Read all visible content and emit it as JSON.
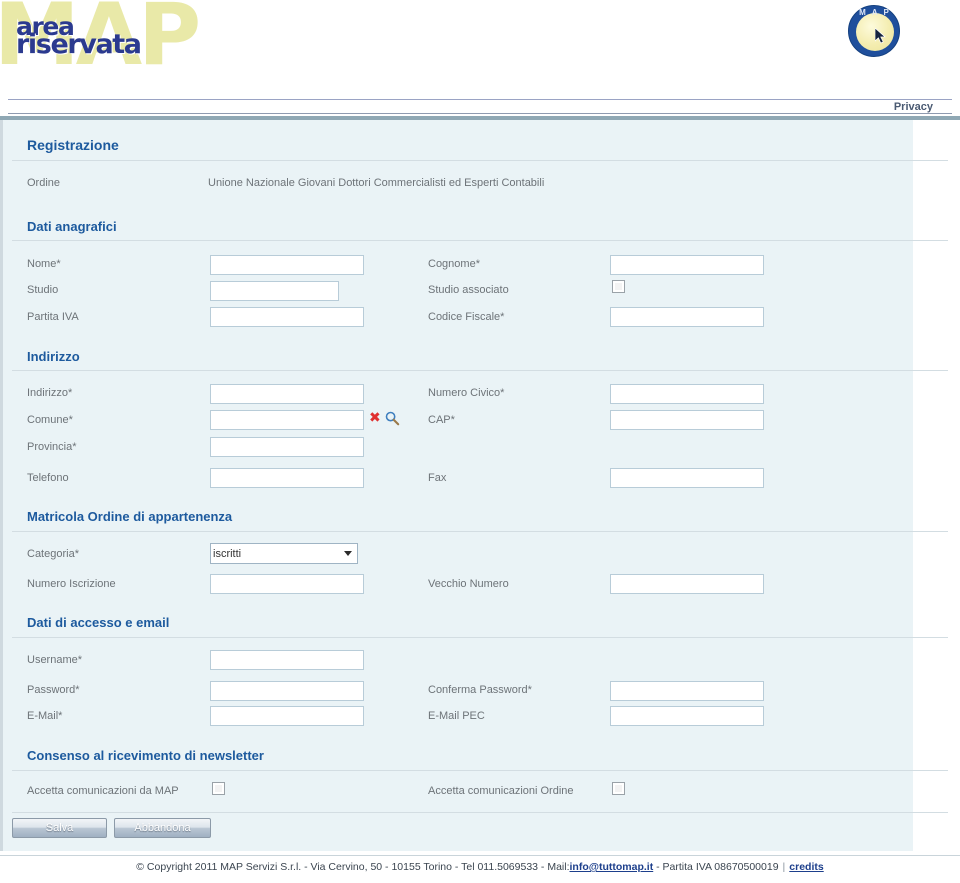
{
  "header": {
    "logo_ghost": "MAP",
    "logo_line1": "area",
    "logo_line2": "riservata",
    "badge_text": "M A P",
    "privacy_label": "Privacy"
  },
  "page": {
    "title": "Registrazione",
    "ordine_label": "Ordine",
    "ordine_value": "Unione Nazionale Giovani Dottori Commercialisti ed Esperti Contabili"
  },
  "sections": {
    "anagrafici": {
      "title": "Dati anagrafici",
      "fields": {
        "nome_label": "Nome*",
        "nome_value": "",
        "cognome_label": "Cognome*",
        "cognome_value": "",
        "studio_label": "Studio",
        "studio_value": "",
        "studio_associato_label": "Studio associato",
        "partita_iva_label": "Partita IVA",
        "partita_iva_value": "",
        "codice_fiscale_label": "Codice Fiscale*",
        "codice_fiscale_value": ""
      }
    },
    "indirizzo": {
      "title": "Indirizzo",
      "fields": {
        "indirizzo_label": "Indirizzo*",
        "indirizzo_value": "",
        "numero_civico_label": "Numero Civico*",
        "numero_civico_value": "",
        "comune_label": "Comune*",
        "comune_value": "",
        "cap_label": "CAP*",
        "cap_value": "",
        "provincia_label": "Provincia*",
        "provincia_value": "",
        "telefono_label": "Telefono",
        "telefono_value": "",
        "fax_label": "Fax",
        "fax_value": ""
      },
      "icons": {
        "clear_icon": "clear-comune-icon",
        "search_icon": "search-comune-icon",
        "clear_glyph": "✖"
      }
    },
    "matricola": {
      "title": "Matricola Ordine di appartenenza",
      "fields": {
        "categoria_label": "Categoria*",
        "categoria_value": "iscritti",
        "categoria_options": [
          "iscritti"
        ],
        "numero_iscrizione_label": "Numero Iscrizione",
        "numero_iscrizione_value": "",
        "vecchio_numero_label": "Vecchio Numero",
        "vecchio_numero_value": ""
      }
    },
    "accesso": {
      "title": "Dati di accesso e email",
      "fields": {
        "username_label": "Username*",
        "username_value": "",
        "password_label": "Password*",
        "password_value": "",
        "conferma_password_label": "Conferma Password*",
        "conferma_password_value": "",
        "email_label": "E-Mail*",
        "email_value": "",
        "email_pec_label": "E-Mail PEC",
        "email_pec_value": ""
      }
    },
    "newsletter": {
      "title": "Consenso al ricevimento di newsletter",
      "fields": {
        "accetta_map_label": "Accetta comunicazioni da MAP",
        "accetta_ordine_label": "Accetta comunicazioni Ordine"
      }
    }
  },
  "buttons": {
    "save_label": "Salva",
    "cancel_label": "Abbandona"
  },
  "footer": {
    "text_before": "© Copyright 2011 MAP Servizi S.r.l. - Via Cervino, 50 - 10155 Torino - Tel 011.5069533 - Mail:",
    "email_link": "info@tuttomap.it",
    "text_after": " - Partita IVA 08670500019",
    "separator": "|",
    "credits_link": "credits"
  },
  "colors": {
    "accent_blue": "#1d5a9e",
    "panel_bg": "#eaf3f6",
    "logo_blue": "#2b3a8f",
    "logo_yellow": "#e9e9a8",
    "clear_red": "#e03030"
  }
}
